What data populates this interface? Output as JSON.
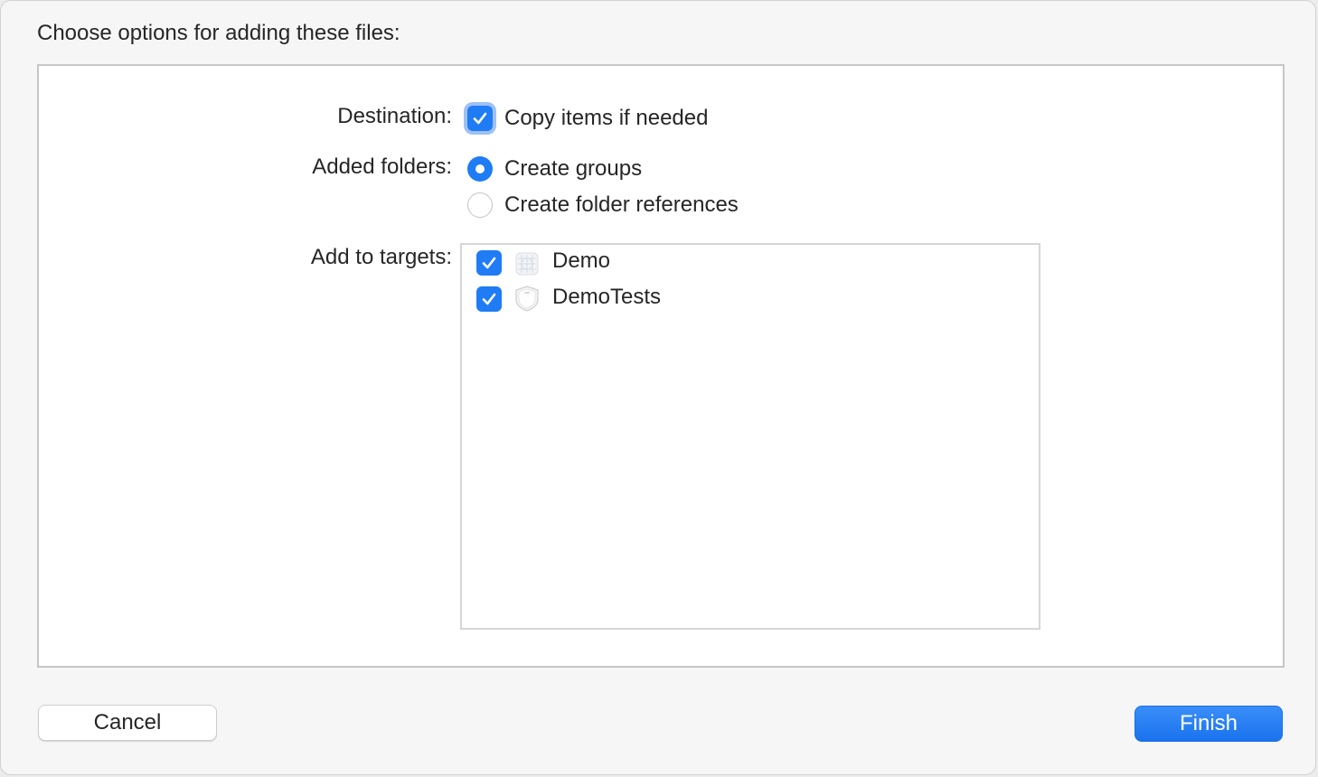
{
  "dialog": {
    "heading": "Choose options for adding these files:"
  },
  "destination": {
    "label": "Destination:",
    "copy_items_label": "Copy items if needed",
    "copy_items_checked": true
  },
  "added_folders": {
    "label": "Added folders:",
    "options": [
      {
        "label": "Create groups",
        "selected": true
      },
      {
        "label": "Create folder references",
        "selected": false
      }
    ]
  },
  "targets": {
    "label": "Add to targets:",
    "items": [
      {
        "name": "Demo",
        "checked": true,
        "icon": "app-target-icon"
      },
      {
        "name": "DemoTests",
        "checked": true,
        "icon": "test-bundle-icon"
      }
    ]
  },
  "buttons": {
    "cancel_label": "Cancel",
    "finish_label": "Finish"
  },
  "colors": {
    "accent": "#1f7cf5"
  }
}
